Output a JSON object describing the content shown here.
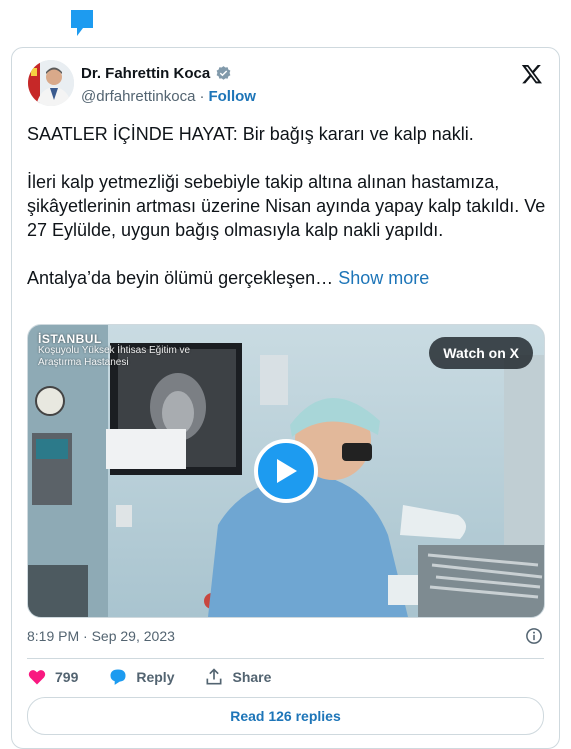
{
  "author": {
    "name": "Dr. Fahrettin Koca",
    "handle": "@drfahrettinkoca",
    "separator": "·",
    "follow_label": "Follow"
  },
  "tweet": {
    "line1": "SAATLER İÇİNDE HAYAT: Bir bağış kararı ve kalp nakli.",
    "para2": "İleri kalp yetmezliği sebebiyle takip altına alınan hastamıza, şikâyetlerinin artması üzerine Nisan ayında yapay kalp takıldı. Ve 27 Eylülde, uygun bağış olmasıyla kalp nakli yapıldı.",
    "para3": "Antalya’da beyin ölümü gerçekleşen…",
    "show_more": "Show more"
  },
  "media": {
    "badge_city": "İSTANBUL",
    "badge_line1": "Koşuyolu Yüksek İhtisas Eğitim ve",
    "badge_line2": "Araştırma Hastanesi",
    "watch_label": "Watch on X"
  },
  "meta": {
    "time": "8:19 PM",
    "separator": "·",
    "date": "Sep 29, 2023"
  },
  "actions": {
    "likes": "799",
    "reply_label": "Reply",
    "share_label": "Share"
  },
  "read_replies_label": "Read 126 replies",
  "colors": {
    "accent": "#1d9bf0",
    "link": "#1d75b8",
    "like": "#f91880",
    "border": "#cfd9de",
    "muted": "#536471"
  },
  "icons": [
    "comment-bubble-icon",
    "verified-badge-icon",
    "x-logo-icon",
    "play-icon",
    "info-icon",
    "heart-icon",
    "reply-bubble-icon",
    "share-icon"
  ]
}
